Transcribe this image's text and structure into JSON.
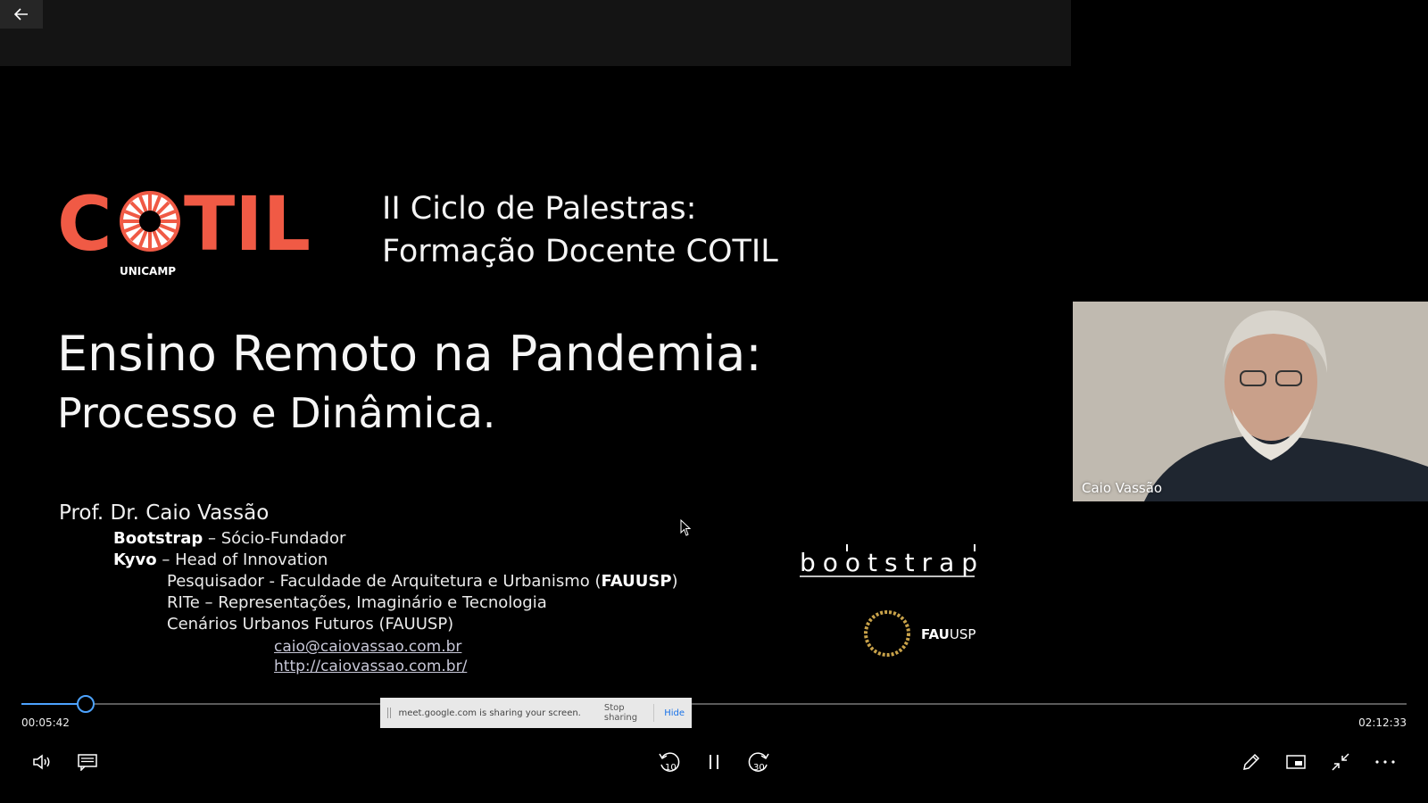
{
  "slide": {
    "logo_text": "COTIL",
    "logo_sub": "UNICAMP",
    "cycle_line1": "II Ciclo de Palestras:",
    "cycle_line2": "Formação Docente COTIL",
    "title_line1": "Ensino Remoto na Pandemia:",
    "title_line2": "Processo e Dinâmica.",
    "professor": "Prof. Dr. Caio Vassão",
    "lines": [
      {
        "bold": "Bootstrap",
        "rest": " – Sócio-Fundador"
      },
      {
        "bold": "Kyvo",
        "rest": " – Head of Innovation"
      },
      {
        "pre": "Pesquisador - Faculdade de Arquitetura e Urbanismo (",
        "bold": "FAUUSP",
        "post": ")"
      },
      {
        "text": "RITe – Representações, Imaginário e Tecnologia"
      },
      {
        "text": "Cenários Urbanos Futuros (FAUUSP)"
      }
    ],
    "email": "caio@caiovassao.com.br",
    "website": "http://caiovassao.com.br/",
    "bootstrap_logo": "bootstrap",
    "fau_logo_bold": "FAU",
    "fau_logo_rest": "USP"
  },
  "camera": {
    "participant_name": "Caio Vassão"
  },
  "player": {
    "current_time": "00:05:42",
    "total_time": "02:12:33",
    "progress": 0.0465,
    "accent": "#4da3ff"
  },
  "share_bar": {
    "message": "meet.google.com is sharing your screen.",
    "stop_label": "Stop sharing",
    "hide_label": "Hide"
  },
  "controls": {
    "rewind_seconds": "10",
    "forward_seconds": "30"
  },
  "colors": {
    "logo_accent": "#f05a45"
  }
}
